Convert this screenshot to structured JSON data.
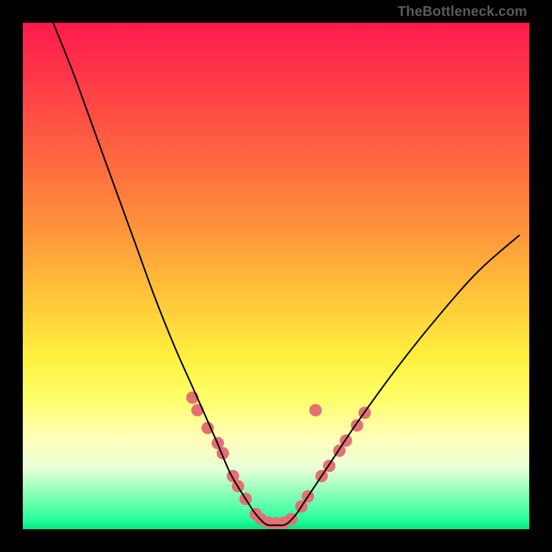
{
  "attribution": "TheBottleneck.com",
  "chart_data": {
    "type": "line",
    "title": "",
    "xlabel": "",
    "ylabel": "",
    "xlim": [
      0,
      100
    ],
    "ylim": [
      0,
      100
    ],
    "grid": false,
    "legend": false,
    "series": [
      {
        "name": "bottleneck-curve",
        "x": [
          6,
          10,
          14,
          18,
          22,
          26,
          30,
          34,
          38,
          41,
          44,
          46,
          48,
          50,
          52,
          54,
          56,
          60,
          66,
          74,
          82,
          90,
          98
        ],
        "values": [
          100,
          90,
          79,
          68,
          57,
          46,
          36,
          27,
          18,
          11,
          6,
          3,
          1,
          0.8,
          1,
          3,
          6,
          12,
          21,
          32,
          42,
          51,
          58
        ]
      }
    ],
    "markers": {
      "name": "sample-points",
      "color": "#e37073",
      "radius_px": 9,
      "points": [
        {
          "x": 33.5,
          "y": 26
        },
        {
          "x": 34.5,
          "y": 23.5
        },
        {
          "x": 36.5,
          "y": 20
        },
        {
          "x": 38.5,
          "y": 17
        },
        {
          "x": 39.5,
          "y": 15
        },
        {
          "x": 41.5,
          "y": 10.5
        },
        {
          "x": 42.5,
          "y": 8.5
        },
        {
          "x": 44.0,
          "y": 6
        },
        {
          "x": 46.0,
          "y": 3
        },
        {
          "x": 47.0,
          "y": 2
        },
        {
          "x": 48.5,
          "y": 1.3
        },
        {
          "x": 50.0,
          "y": 1.2
        },
        {
          "x": 51.5,
          "y": 1.3
        },
        {
          "x": 53.0,
          "y": 2
        },
        {
          "x": 55.0,
          "y": 4.5
        },
        {
          "x": 56.3,
          "y": 6.5
        },
        {
          "x": 59.0,
          "y": 10.5
        },
        {
          "x": 60.5,
          "y": 12.5
        },
        {
          "x": 62.5,
          "y": 15.5
        },
        {
          "x": 63.8,
          "y": 17.5
        },
        {
          "x": 66.0,
          "y": 20.5
        },
        {
          "x": 67.5,
          "y": 23
        },
        {
          "x": 57.8,
          "y": 23.5
        }
      ]
    }
  }
}
